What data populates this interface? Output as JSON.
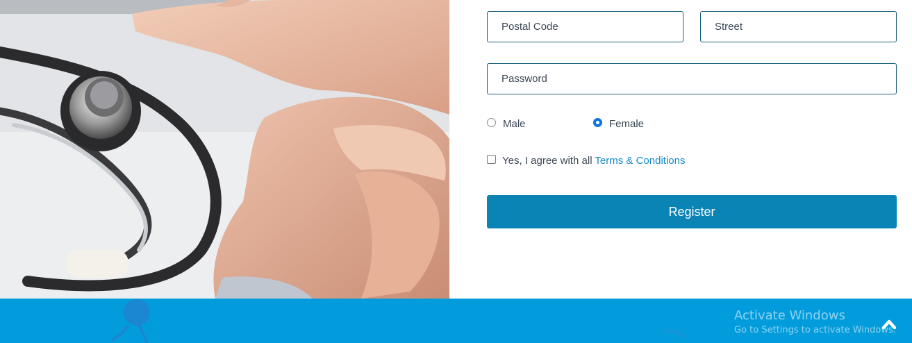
{
  "form": {
    "postal_code_placeholder": "Postal Code",
    "street_placeholder": "Street",
    "password_placeholder": "Password",
    "gender": {
      "options": [
        "Male",
        "Female"
      ],
      "selected": "Female"
    },
    "agree_text": "Yes, I agree with all ",
    "terms_link": "Terms & Conditions",
    "agree_checked": false,
    "register_label": "Register"
  },
  "overlay": {
    "activate_title": "Activate Windows",
    "activate_sub": "Go to Settings to activate Windows."
  },
  "colors": {
    "accent": "#0a84b4",
    "footer": "#029cdc",
    "link": "#1989c9",
    "radio_selected": "#0b74e5"
  },
  "icons": {
    "scroll_top": "chevron-up-icon"
  }
}
